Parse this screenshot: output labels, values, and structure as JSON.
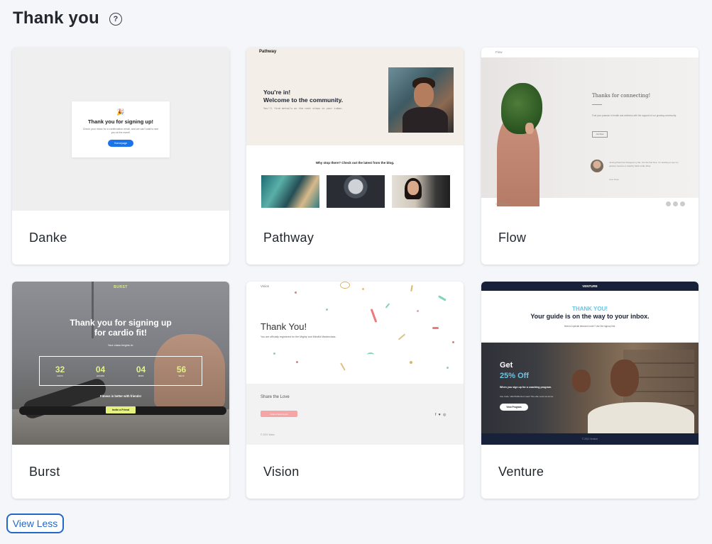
{
  "header": {
    "title": "Thank you",
    "help_glyph": "?"
  },
  "templates": [
    {
      "label": "Danke",
      "preview": {
        "emoji": "🎉",
        "heading": "Thank you for signing up!",
        "body": "Check your inbox for a confirmation email, and we can't wait to see you at the event!",
        "button": "Homepage"
      }
    },
    {
      "label": "Pathway",
      "preview": {
        "logo": "Pathway",
        "heading_line1": "You're in!",
        "heading_line2": "Welcome to the community.",
        "subtext": "You'll find details on the next steps in your inbox.",
        "blog_heading": "Why stop there? Check out the latest from the blog."
      }
    },
    {
      "label": "Flow",
      "preview": {
        "logo": "Flow",
        "heading": "Thanks for connecting!",
        "body": "Fuel your passion in health and wellness with the support of our growing community.",
        "button": "Join Now",
        "quote": "Joining Flow has changed my life. For the first time, I'm starting to see my passion become a healthy habit a little Fiber.",
        "quote_author": "Jane Rowe",
        "copyright": "© 2021 Flow"
      }
    },
    {
      "label": "Burst",
      "preview": {
        "logo": "BURST",
        "heading_line1": "Thank you for signing up",
        "heading_line2": "for cardio fit!",
        "subtext": "Your class begins in:",
        "countdown": [
          {
            "value": "32",
            "unit": "DAYS"
          },
          {
            "value": "04",
            "unit": "HOURS"
          },
          {
            "value": "04",
            "unit": "MINS"
          },
          {
            "value": "56",
            "unit": "SECS"
          }
        ],
        "tagline": "Fitness is better with friends!",
        "button": "Invite a Friend"
      }
    },
    {
      "label": "Vision",
      "preview": {
        "logo": "Vision",
        "heading": "Thank You!",
        "body": "You are officially registered for the Mighty and Mindful Masterclass.",
        "share_heading": "Share the Love",
        "share_button": "Invite a friend to join",
        "social_glyphs": "f ♥ ◎",
        "copyright": "© 2021 Vision"
      }
    },
    {
      "label": "Venture",
      "preview": {
        "logo": "VENTURE",
        "thanks": "THANK YOU!",
        "heading": "Your guide is on the way to your inbox.",
        "subtext": "Need a special discount code? Use the signup link.",
        "offer_line1": "Get",
        "offer_line2": "25% Off",
        "offer_body": "When you sign up for a coaching program.",
        "offer_code": "Use Code: VENTURE Don't wait! This offer ends tomorrow.",
        "button": "View Program",
        "footer": "© 2021 Venture"
      }
    }
  ],
  "footer": {
    "view_less_label": "View Less"
  },
  "colors": {
    "accent": "#2268c9",
    "venture_navy": "#17213a",
    "burst_lime": "#e6f27c",
    "vision_pink": "#f5a5a5"
  }
}
